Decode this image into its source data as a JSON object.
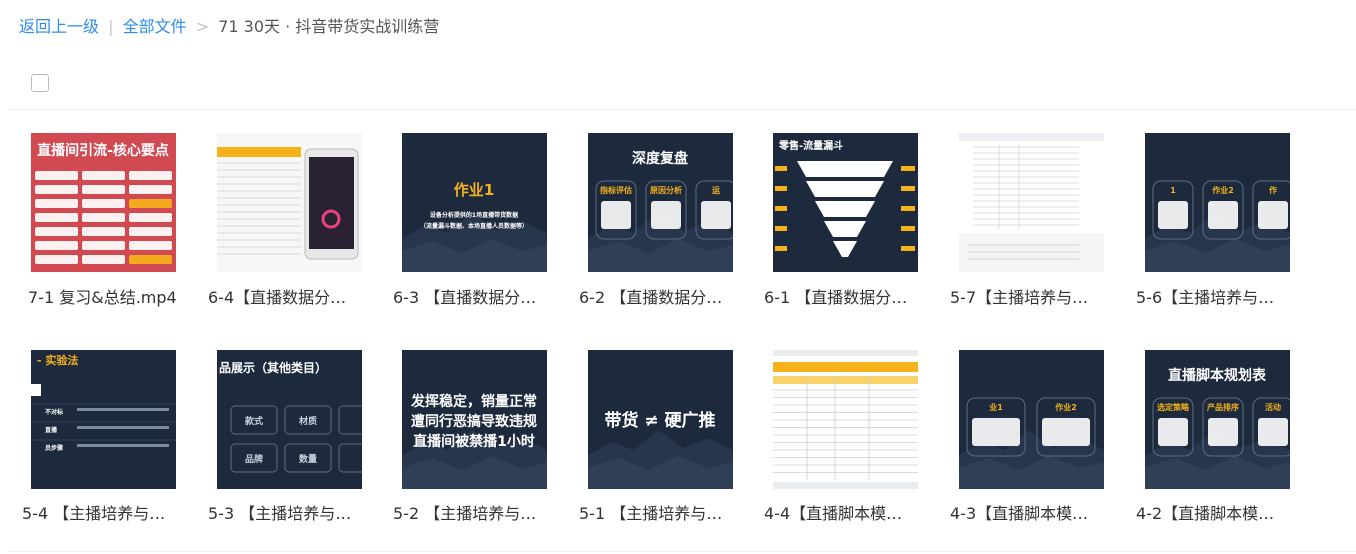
{
  "breadcrumb": {
    "back": "返回上一级",
    "separator": "|",
    "all_files": "全部文件",
    "arrow": ">",
    "current": "71 30天 · 抖音带货实战训练营"
  },
  "files": [
    {
      "name": "7-1 复习&总结.mp4",
      "thumb": {
        "style": "red",
        "title": "直播间引流-核心要点"
      }
    },
    {
      "name": "6-4【直播数据分…",
      "thumb": {
        "style": "sheet-phone"
      }
    },
    {
      "name": "6-3 【直播数据分…",
      "thumb": {
        "style": "dark",
        "title": "作业1",
        "lines": [
          "设备分析提供的1场直播带货数据",
          "（流量漏斗数据、本场直播人员数据等）"
        ]
      }
    },
    {
      "name": "6-2 【直播数据分…",
      "thumb": {
        "style": "dark-cards",
        "title": "深度复盘",
        "labels": [
          "指标评估",
          "原因分析",
          "运"
        ]
      }
    },
    {
      "name": "6-1 【直播数据分…",
      "thumb": {
        "style": "funnel",
        "title": "零售-流量漏斗"
      }
    },
    {
      "name": "5-7【主播培养与…",
      "thumb": {
        "style": "doc"
      }
    },
    {
      "name": "5-6【主播培养与…",
      "thumb": {
        "style": "dark-cards",
        "title": "作业2",
        "labels": [
          "1",
          "作业2",
          "作"
        ]
      }
    },
    {
      "name": "5-4 【主播培养与…",
      "thumb": {
        "style": "dark-table",
        "title": "- 实验法",
        "rows": [
          "不对标",
          "直播",
          "员步骤"
        ]
      }
    },
    {
      "name": "5-3 【主播培养与…",
      "thumb": {
        "style": "dark-grid",
        "title": "品展示（其他类目）",
        "labels": [
          "款式",
          "材质",
          "品牌",
          "数量"
        ]
      }
    },
    {
      "name": "5-2 【主播培养与…",
      "thumb": {
        "style": "dark",
        "title": "",
        "lines": [
          "发挥稳定，销量正常",
          "遭同行恶搞导致违规",
          "直播间被禁播1小时"
        ]
      }
    },
    {
      "name": "5-1 【主播培养与…",
      "thumb": {
        "style": "dark",
        "title": "",
        "lines": [
          "带货 ≠ 硬广推"
        ]
      }
    },
    {
      "name": "4-4【直播脚本模…",
      "thumb": {
        "style": "sheet-yellow"
      }
    },
    {
      "name": "4-3【直播脚本模…",
      "thumb": {
        "style": "dark-cards",
        "title": "作业2",
        "labels": [
          "业1",
          "作业2"
        ]
      }
    },
    {
      "name": "4-2【直播脚本模…",
      "thumb": {
        "style": "dark-cards",
        "title": "直播脚本规划表",
        "labels": [
          "选定策略",
          "产品排序",
          "活动"
        ]
      }
    }
  ],
  "colors": {
    "link": "#2d8cf0",
    "gold": "#f5b21a",
    "navy": "#1d2a3d",
    "red": "#d14a52"
  }
}
